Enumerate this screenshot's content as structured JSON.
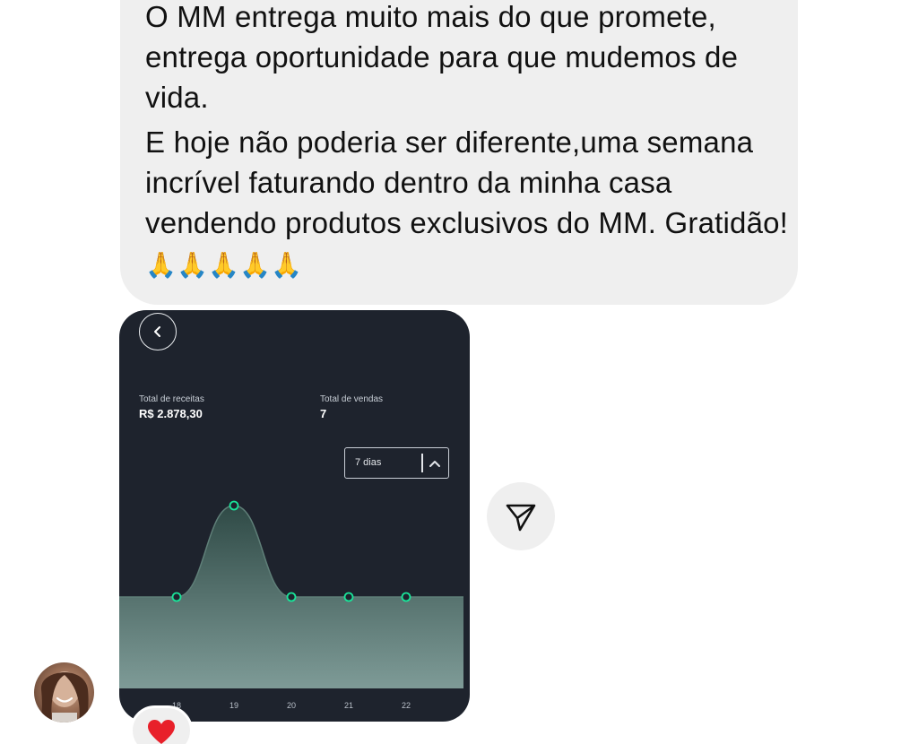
{
  "message": {
    "paragraphs": [
      "O MM entrega muito mais do que promete, entrega oportunidade para que mudemos de vida.",
      "E hoje não poderia ser diferente,uma semana incrível faturando dentro da minha casa vendendo produtos exclusivos do MM. Gratidão!"
    ],
    "emoji": "🙏🙏🙏🙏🙏",
    "emoji_icon": "folded-hands-icon"
  },
  "shared_screenshot": {
    "revenue": {
      "label": "Total de receitas",
      "value": "R$ 2.878,30"
    },
    "sales": {
      "label": "Total de vendas",
      "value": "7"
    },
    "period": {
      "value": "7 dias"
    },
    "colors": {
      "background": "#1e232d",
      "line": "#5f7f78",
      "area_top": "#2f4a46",
      "area_bottom": "#7e9b97",
      "point": "#19e59a"
    },
    "chart_data": {
      "type": "area",
      "x": [
        "18",
        "19",
        "20",
        "21",
        "22"
      ],
      "series": [
        {
          "values": [
            1,
            3,
            1,
            1,
            1
          ]
        }
      ]
    }
  },
  "share_button": {
    "icon": "paper-plane-icon"
  },
  "reaction": {
    "emoji": "❤️",
    "icon": "heart-icon",
    "color": "#e8202a"
  }
}
